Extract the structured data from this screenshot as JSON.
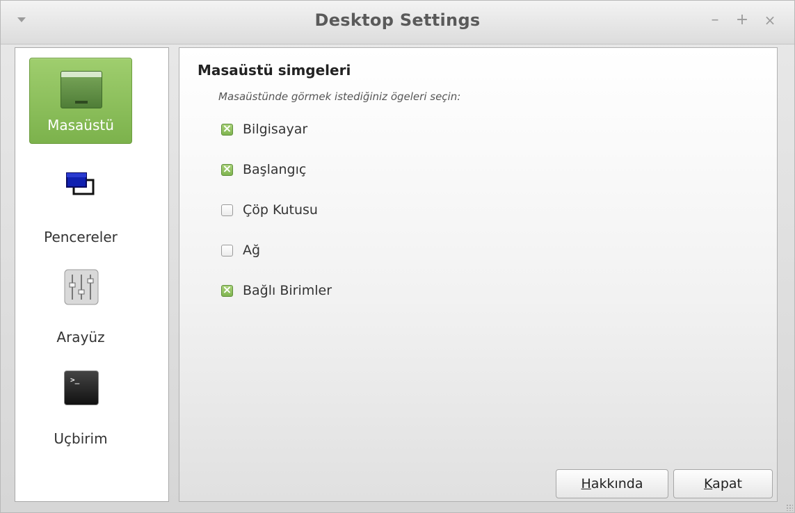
{
  "window": {
    "title": "Desktop Settings",
    "controls": {
      "minimize": "–",
      "maximize": "+",
      "close": "×"
    }
  },
  "sidebar": {
    "items": [
      {
        "label": "Masaüstü",
        "icon": "desktop-icon",
        "active": true
      },
      {
        "label": "Pencereler",
        "icon": "windows-icon",
        "active": false
      },
      {
        "label": "Arayüz",
        "icon": "sliders-icon",
        "active": false
      },
      {
        "label": "Uçbirim",
        "icon": "terminal-icon",
        "active": false
      }
    ]
  },
  "main": {
    "section_title": "Masaüstü simgeleri",
    "section_desc": "Masaüstünde görmek istediğiniz ögeleri seçin:",
    "options": [
      {
        "label": "Bilgisayar",
        "checked": true
      },
      {
        "label": "Başlangıç",
        "checked": true
      },
      {
        "label": "Çöp Kutusu",
        "checked": false
      },
      {
        "label": "Ağ",
        "checked": false
      },
      {
        "label": "Bağlı Birimler",
        "checked": true
      }
    ]
  },
  "buttons": {
    "about": {
      "mnemonic": "H",
      "rest": "akkında"
    },
    "close": {
      "mnemonic": "K",
      "rest": "apat"
    }
  },
  "colors": {
    "accent": "#8cc05e",
    "terminal": "#1a1a1a"
  }
}
